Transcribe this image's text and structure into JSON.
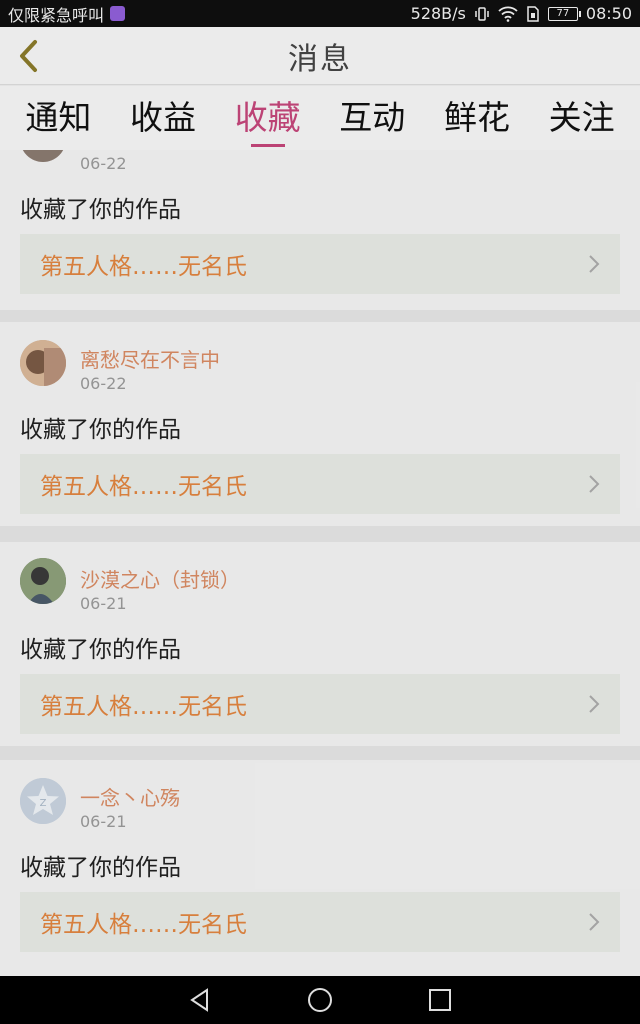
{
  "status_bar": {
    "left_text": "仅限紧急呼叫",
    "app_icon": "calendar-icon",
    "speed": "528B/s",
    "battery": "77",
    "time": "08:50"
  },
  "header": {
    "title": "消息",
    "back_icon": "chevron-left-icon"
  },
  "tabs": [
    {
      "label": "通知",
      "active": false
    },
    {
      "label": "收益",
      "active": false
    },
    {
      "label": "收藏",
      "active": true
    },
    {
      "label": "互动",
      "active": false
    },
    {
      "label": "鲜花",
      "active": false
    },
    {
      "label": "关注",
      "active": false
    }
  ],
  "feed": [
    {
      "user": "",
      "date": "06-22",
      "action": "收藏了你的作品",
      "work": "第五人格……无名氏"
    },
    {
      "user": "离愁尽在不言中",
      "date": "06-22",
      "action": "收藏了你的作品",
      "work": "第五人格……无名氏"
    },
    {
      "user": "沙漠之心（封锁）",
      "date": "06-21",
      "action": "收藏了你的作品",
      "work": "第五人格……无名氏"
    },
    {
      "user": "一念丶心殇",
      "date": "06-21",
      "action": "收藏了你的作品",
      "work": "第五人格……无名氏"
    }
  ],
  "colors": {
    "accent": "#c4467a",
    "username": "#d98b63",
    "work_title": "#e08540"
  }
}
